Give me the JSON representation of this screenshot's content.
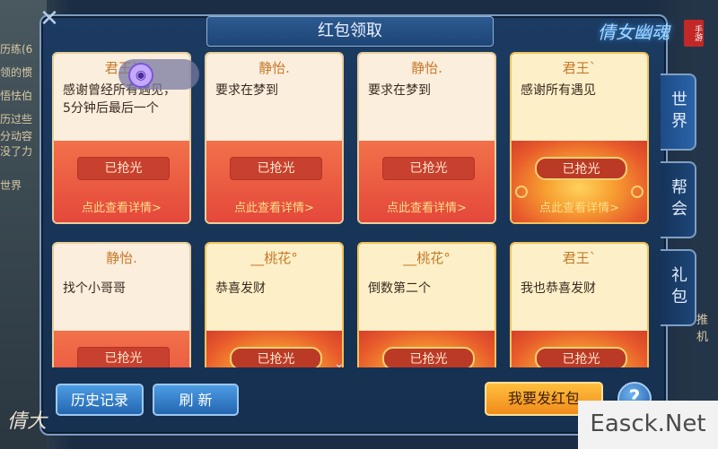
{
  "dialog": {
    "title": "红包领取",
    "close_icon": "close-icon"
  },
  "logo": {
    "text": "倩女幽魂",
    "seal": "手游"
  },
  "cards": [
    {
      "sender": "君王`",
      "message": "感谢曾经所有遇见，5分钟后最后一个",
      "status": "已抢光",
      "details": "点此查看详情>",
      "style": "red"
    },
    {
      "sender": "静怡.",
      "message": "要求在梦到",
      "status": "已抢光",
      "details": "点此查看详情>",
      "style": "red"
    },
    {
      "sender": "静怡.",
      "message": "要求在梦到",
      "status": "已抢光",
      "details": "点此查看详情>",
      "style": "red"
    },
    {
      "sender": "君王`",
      "message": "感谢所有遇见",
      "status": "已抢光",
      "details": "点此查看详情>",
      "style": "gold"
    },
    {
      "sender": "静怡.",
      "message": "找个小哥哥",
      "status": "已抢光",
      "details": "",
      "style": "red"
    },
    {
      "sender": "__桃花°",
      "message": "恭喜发财",
      "status": "已抢光",
      "details": "",
      "style": "gold"
    },
    {
      "sender": "__桃花°",
      "message": "倒数第二个",
      "status": "已抢光",
      "details": "",
      "style": "gold"
    },
    {
      "sender": "君王`",
      "message": "我也恭喜发财",
      "status": "已抢光",
      "details": "",
      "style": "gold"
    }
  ],
  "tabs": [
    {
      "label": "世界",
      "active": true
    },
    {
      "label": "帮会",
      "active": false
    },
    {
      "label": "礼包",
      "active": false
    }
  ],
  "buttons": {
    "history": "历史记录",
    "refresh": "刷 新",
    "send": "我要发红包",
    "help": "?"
  },
  "background_chat": [
    "历练(6",
    "领的惯",
    "悟怯伯",
    "历过些",
    "分动容",
    "没了力",
    "世界"
  ],
  "right_bg_text": "推机",
  "watermark": "Easck.Net",
  "signature": "倩大",
  "colors": {
    "panel": "#1c3b62",
    "card_red": "#e4463a",
    "card_gold": "#f7a031",
    "details_text": "#ffde8a",
    "sender_text": "#c6792a"
  }
}
